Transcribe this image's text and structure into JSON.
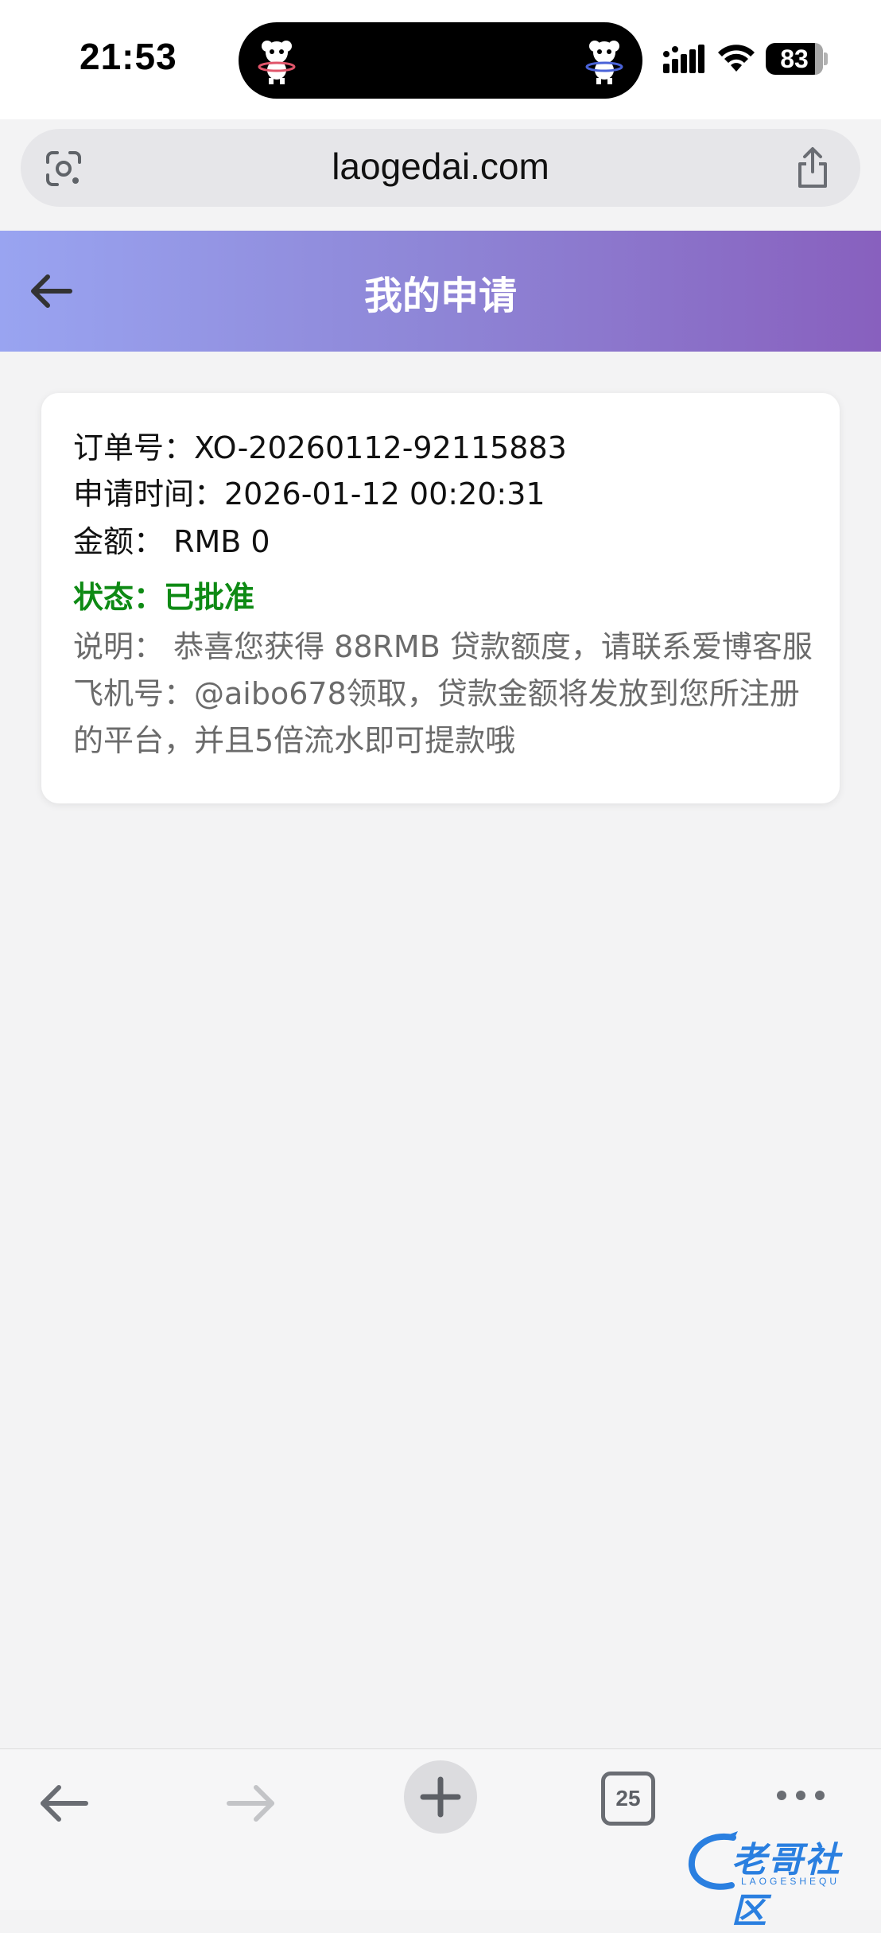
{
  "status_bar": {
    "time": "21:53",
    "battery": "83"
  },
  "browser": {
    "url": "laogedai.com"
  },
  "header": {
    "title": "我的申请"
  },
  "application": {
    "order": "订单号：XO-20260112-92115883",
    "apply_time": "申请时间：2026-01-12 00:20:31",
    "amount": "金额：  RMB 0",
    "status": "状态：已批准",
    "description": "说明：  恭喜您获得 88RMB 贷款额度，请联系爱博客服飞机号：@aibo678领取，贷款金额将发放到您所注册的平台，并且5倍流水即可提款哦"
  },
  "toolbar": {
    "tab_count": "25"
  },
  "watermark": {
    "text": "老哥社区",
    "sub": "LAOGESHEQU"
  },
  "colors": {
    "status_approved": "#0e8a14",
    "header_gradient_start": "#99a4f1",
    "header_gradient_end": "#8860be"
  }
}
